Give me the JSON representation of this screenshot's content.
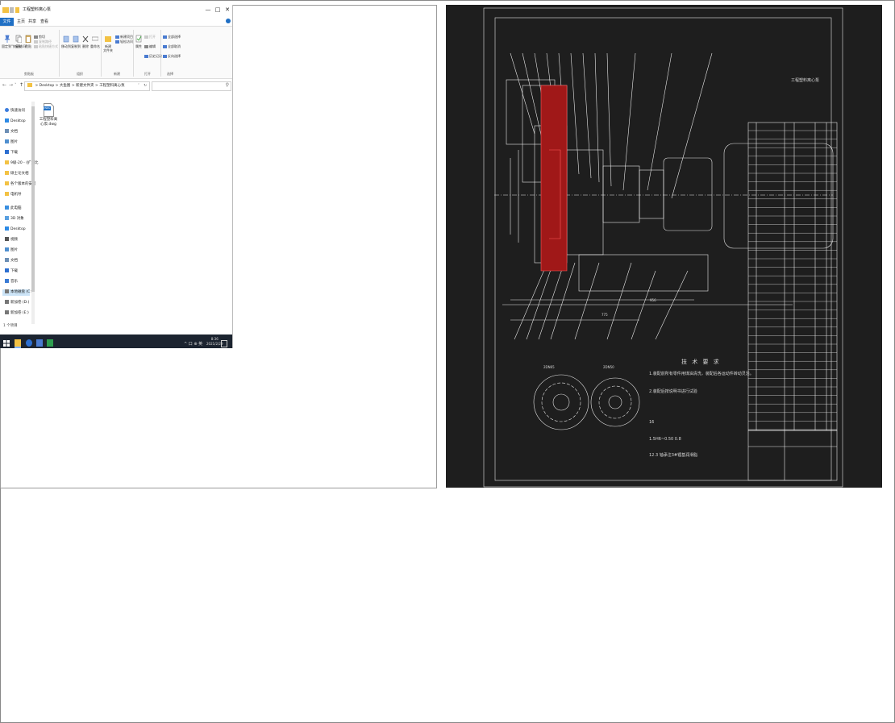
{
  "window": {
    "title": "工程塑料离心泵",
    "controls": {
      "minimize": "—",
      "maximize": "□",
      "close": "✕"
    }
  },
  "menu": {
    "file": "文件",
    "home": "主页",
    "share": "共享",
    "view": "查看"
  },
  "ribbon": {
    "pin_label": "固定到\"快速访问\"",
    "copy_label": "复制",
    "paste_label": "粘贴",
    "cut_label": "剪切",
    "copy_path_label": "复制路径",
    "paste_shortcut_label": "粘贴快捷方式",
    "move_to_label": "移动到",
    "copy_to_label": "复制到",
    "delete_label": "删除",
    "rename_label": "重命名",
    "new_folder_label": "新建\n文件夹",
    "new_item_label": "新建项目",
    "easy_access_label": "轻松访问",
    "properties_label": "属性",
    "open_label": "打开",
    "edit_label": "编辑",
    "history_label": "历史记录",
    "select_all_label": "全部选择",
    "select_none_label": "全部取消",
    "invert_label": "反向选择",
    "groups": {
      "clipboard": "剪贴板",
      "organize": "组织",
      "new": "新建",
      "open": "打开",
      "select": "选择"
    }
  },
  "address": {
    "path": [
      "Desktop",
      "大鱼图",
      "新建文件夹",
      "工程塑料离心泵"
    ],
    "separator": ">",
    "search_placeholder": ""
  },
  "sidebar": {
    "items": [
      {
        "label": "快速访问",
        "icon": "star-icon"
      },
      {
        "label": "Desktop",
        "icon": "desktop-icon"
      },
      {
        "label": "文档",
        "icon": "document-icon"
      },
      {
        "label": "图片",
        "icon": "picture-icon"
      },
      {
        "label": "下载",
        "icon": "download-icon"
      },
      {
        "label": "9级-20 - (扩大比",
        "icon": "folder-icon"
      },
      {
        "label": "硕士论文相",
        "icon": "folder-icon"
      },
      {
        "label": "各个版本的安装",
        "icon": "folder-icon"
      },
      {
        "label": "电机导",
        "icon": "folder-icon"
      },
      {
        "label": "此电脑",
        "icon": "pc-icon"
      },
      {
        "label": "3D 对象",
        "icon": "cube-icon"
      },
      {
        "label": "Desktop",
        "icon": "desktop-icon"
      },
      {
        "label": "视频",
        "icon": "video-icon"
      },
      {
        "label": "图片",
        "icon": "picture-icon"
      },
      {
        "label": "文档",
        "icon": "document-icon"
      },
      {
        "label": "下载",
        "icon": "download-icon"
      },
      {
        "label": "音乐",
        "icon": "music-icon"
      },
      {
        "label": "本地磁盘 (C:)",
        "icon": "drive-icon"
      },
      {
        "label": "新加卷 (D:)",
        "icon": "drive-icon"
      },
      {
        "label": "新加卷 (E:)",
        "icon": "drive-icon"
      }
    ]
  },
  "files": [
    {
      "name": "工程塑料离心泵.dwg",
      "icon": "dwg-file-icon",
      "badge": "DWG"
    }
  ],
  "status": {
    "count": "1 个项目"
  },
  "taskbar": {
    "tray": "^ 口 ⊕ 英",
    "time": "8:36",
    "date": "2021/2/29"
  },
  "cad": {
    "title_text": "工程塑料离心泵",
    "tech_title": "技 术 要 求",
    "tech_lines": [
      "1.装配前所有零件用煤油清洗，装配后各运动件转动灵活。",
      "2.装配后按说明书进行试验",
      "16",
      "1.5H6~0.50 0.8",
      "12.3 轴承注3#锂基润滑脂"
    ],
    "dim_labels": [
      "2DN65",
      "2DN50",
      "775",
      "956"
    ]
  },
  "colors": {
    "cad_bg": "#1e1e1e",
    "cad_line": "#e8e8e8",
    "cad_red": "#ff5a5a",
    "accent": "#1f6fc4",
    "taskbar": "#1c2430"
  }
}
